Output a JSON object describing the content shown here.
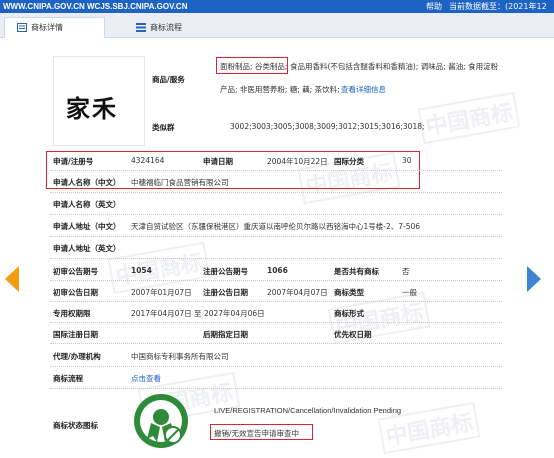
{
  "topbar": {
    "site": "WWW.CNIPA.GOV.CN WCJS.SBJ.CNIPA.GOV.CN",
    "help": "帮助",
    "date": "当前数据截至：(2021年12月09日)"
  },
  "tabs": [
    {
      "label": "商标详情"
    },
    {
      "label": "商标流程"
    }
  ],
  "trademark": {
    "logo_text": "家禾"
  },
  "goods": {
    "label": "商品/服务",
    "highlight": "面粉制品; 谷类制品;",
    "line1_rest": "食品用香料(不包括含醚香料和香精油); 调味品; 酱油; 食用淀粉",
    "line2": "产品; 非医用营养粉; 糖; 藕; 茶饮料;",
    "more_link": "查看详细信息"
  },
  "similar_group": {
    "label": "类似群",
    "value": "3002;3003;3005;3008;3009;3012;3015;3016;3018;"
  },
  "rows": {
    "reg_no_label": "申请/注册号",
    "reg_no": "4324164",
    "apply_date_label": "申请日期",
    "apply_date": "2004年10月22日",
    "intl_class_label": "国际分类",
    "intl_class": "30",
    "applicant_cn_label": "申请人名称（中文）",
    "applicant_cn": "中穗福临门食品营销有限公司",
    "applicant_en_label": "申请人名称（英文）",
    "applicant_en": "",
    "address_cn_label": "申请人地址（中文）",
    "address_cn": "天津自贸试验区（东疆保税港区）重庆道以南呼伦贝尔路以西铭海中心1号楼-2、7-506",
    "address_en_label": "申请人地址（英文）",
    "address_en": "",
    "prelim_no_label": "初审公告期号",
    "prelim_no": "1054",
    "reg_pub_no_label": "注册公告期号",
    "reg_pub_no": "1066",
    "shared_label": "是否共有商标",
    "shared": "否",
    "prelim_date_label": "初审公告日期",
    "prelim_date": "2007年01月07日",
    "reg_pub_date_label": "注册公告日期",
    "reg_pub_date": "2007年04月07日",
    "tm_type_label": "商标类型",
    "tm_type": "一般",
    "exclusive_label": "专用权期限",
    "exclusive": "2017年04月07日 至 2027年04月06日",
    "tm_form_label": "商标形式",
    "tm_form": "",
    "intl_reg_date_label": "国际注册日期",
    "later_date_label": "后期指定日期",
    "priority_date_label": "优先权日期",
    "agent_label": "代理/办理机构",
    "agent": "中国商标专利事务所有限公司",
    "process_label": "商标流程",
    "process_link": "点击查看",
    "status_label": "商标状态图标"
  },
  "status": {
    "en": "LIVE/REGISTRATION/Cancellation/Invalidation Pending",
    "cn": "撤销/无效宣告申请审查中"
  },
  "watermark": "中国商标",
  "colors": {
    "topbar": "#1d63c4",
    "highlight_border": "#e0242b",
    "link": "#1a5fc6",
    "left_arrow": "#f39b11",
    "right_arrow": "#3c86d3",
    "status_icon": "#2e8b3a"
  }
}
